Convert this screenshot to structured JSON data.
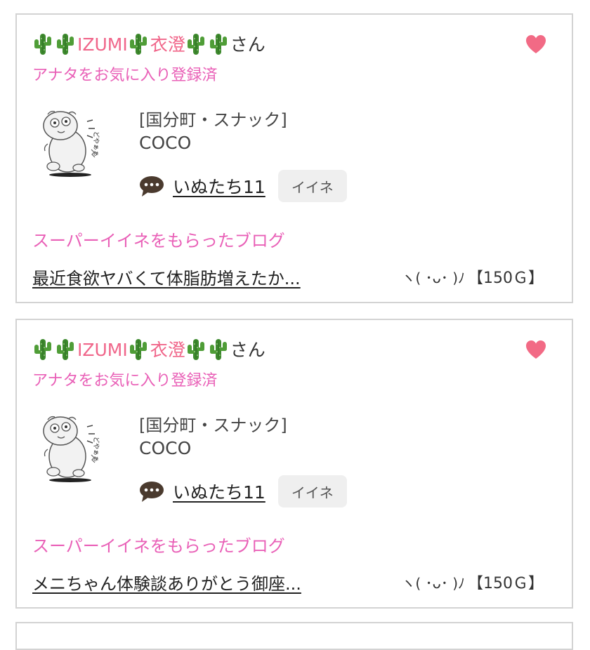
{
  "cards": [
    {
      "user": {
        "name_en": "IZUMI",
        "name_jp": "衣澄",
        "suffix": "さん"
      },
      "favorite_status": "アナタをお気に入り登録済",
      "shop": {
        "category": "[国分町・スナック]",
        "name": "COCO"
      },
      "chat": {
        "username": "いぬたち11",
        "like_label": "イイネ"
      },
      "super_label": "スーパーイイネをもらったブログ",
      "blog": {
        "title": "最近食欲ヤバくて体脂肪増えたか...",
        "face": "ヽ( ･ᴗ･ )ﾉ",
        "reward": "【150Ｇ】"
      }
    },
    {
      "user": {
        "name_en": "IZUMI",
        "name_jp": "衣澄",
        "suffix": "さん"
      },
      "favorite_status": "アナタをお気に入り登録済",
      "shop": {
        "category": "[国分町・スナック]",
        "name": "COCO"
      },
      "chat": {
        "username": "いぬたち11",
        "like_label": "イイネ"
      },
      "super_label": "スーパーイイネをもらったブログ",
      "blog": {
        "title": "メニちゃん体験談ありがとう御座...",
        "face": "ヽ( ･ᴗ･ )ﾉ",
        "reward": "【150Ｇ】"
      }
    }
  ],
  "icons": {
    "cactus": "cactus-icon",
    "heart": "heart-icon",
    "chat": "speech-bubble-icon",
    "avatar": "cartoon-mascot-avatar"
  },
  "colors": {
    "name_pink": "#f0668a",
    "favorite_text": "#e960b7",
    "heart": "#f26a85",
    "chat_icon": "#4a3a2e",
    "border": "#d3d3d3"
  }
}
